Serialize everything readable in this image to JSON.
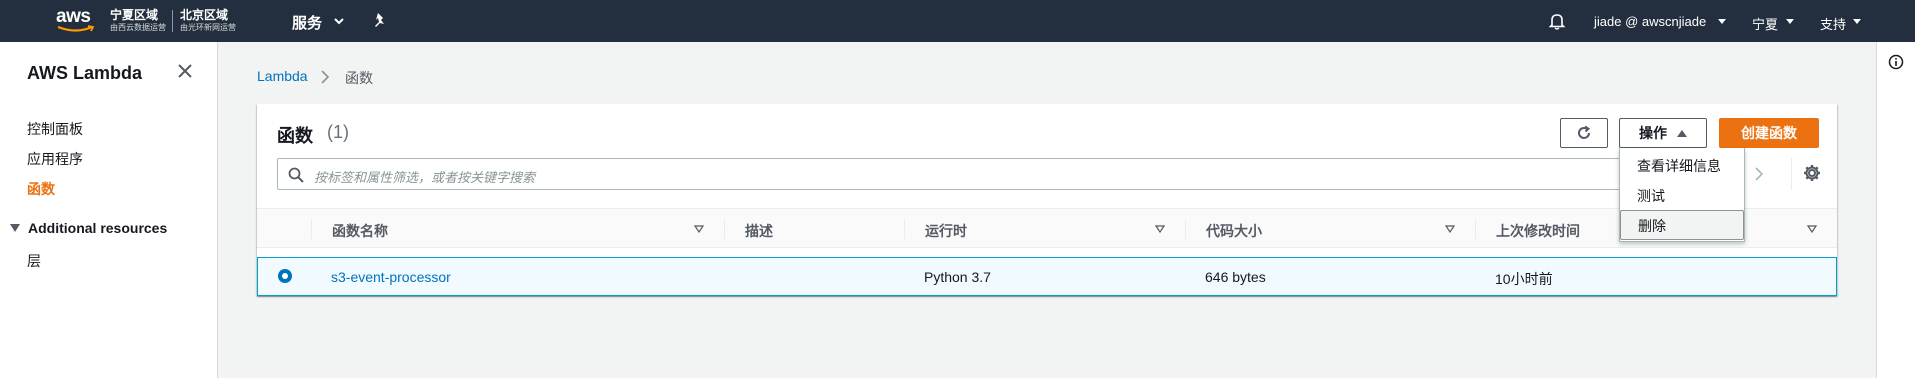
{
  "topnav": {
    "logo_text": "aws",
    "region1": {
      "main": "宁夏区域",
      "sub": "由西云数据运营"
    },
    "region2": {
      "main": "北京区域",
      "sub": "由光环新网运营"
    },
    "services_label": "服务",
    "user_label": "jiade @ awscnjiade",
    "region_label": "宁夏",
    "support_label": "支持"
  },
  "sidebar": {
    "title": "AWS Lambda",
    "items": [
      {
        "label": "控制面板"
      },
      {
        "label": "应用程序"
      },
      {
        "label": "函数"
      }
    ],
    "section_label": "Additional resources",
    "section_items": [
      {
        "label": "层"
      }
    ]
  },
  "breadcrumb": {
    "root": "Lambda",
    "current": "函数"
  },
  "panel": {
    "title": "函数",
    "count": "(1)",
    "actions_label": "操作",
    "create_label": "创建函数",
    "search_placeholder": "按标签和属性筛选，或者按关键字搜索"
  },
  "actions_menu": {
    "items": [
      "查看详细信息",
      "测试",
      "删除"
    ]
  },
  "table": {
    "columns": [
      "函数名称",
      "描述",
      "运行时",
      "代码大小",
      "上次修改时间"
    ],
    "rows": [
      {
        "name": "s3-event-processor",
        "description": "",
        "runtime": "Python 3.7",
        "code_size": "646 bytes",
        "last_modified": "10小时前",
        "selected": true
      }
    ]
  },
  "colors": {
    "nav_bg": "#232f3e",
    "accent": "#ec7211",
    "link": "#0073bb",
    "selected_row_bg": "#f1faff",
    "selected_row_border": "#00a1c9"
  }
}
